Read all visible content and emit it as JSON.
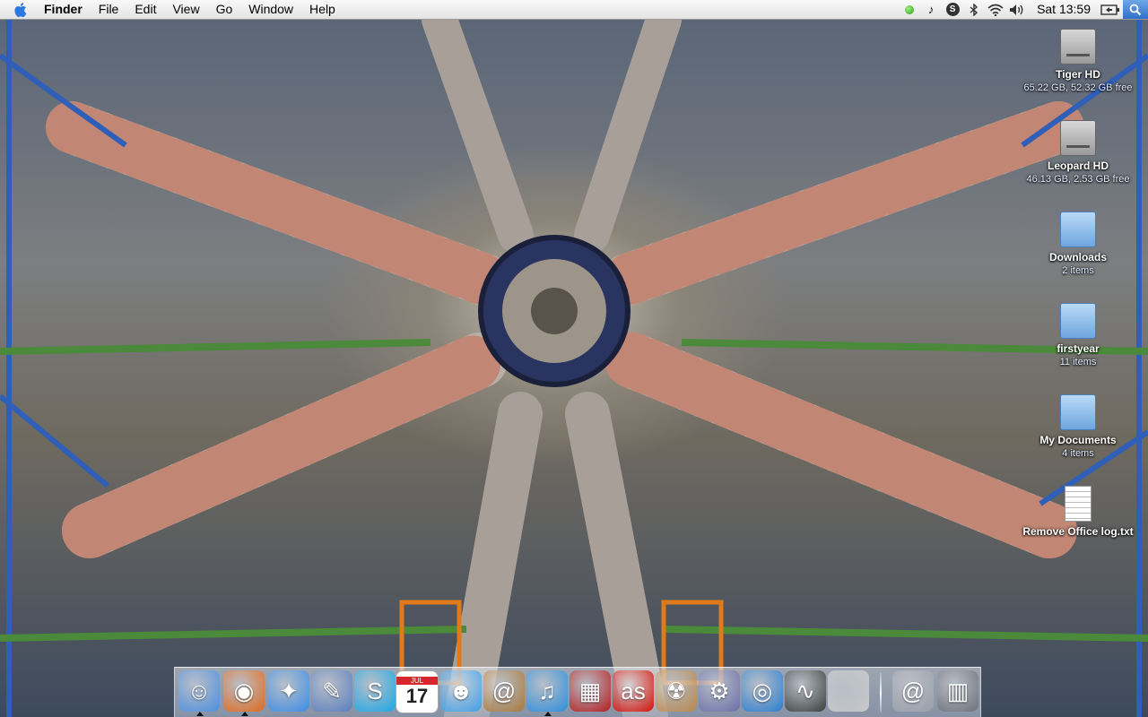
{
  "menubar": {
    "app_name": "Finder",
    "items": [
      "File",
      "Edit",
      "View",
      "Go",
      "Window",
      "Help"
    ],
    "clock": "Sat 13:59"
  },
  "status_icons": [
    "green-status-light-icon",
    "itunes-note-icon",
    "skype-status-icon",
    "bluetooth-icon",
    "wifi-icon",
    "volume-icon",
    "battery-icon",
    "spotlight-icon"
  ],
  "desktop": {
    "icons": [
      {
        "label": "Tiger HD",
        "info": "65.22 GB, 52.32 GB free",
        "kind": "hard-drive"
      },
      {
        "label": "Leopard HD",
        "info": "46.13 GB, 2.53 GB free",
        "kind": "hard-drive"
      },
      {
        "label": "Downloads",
        "info": "2 items",
        "kind": "folder"
      },
      {
        "label": "firstyear",
        "info": "11 items",
        "kind": "folder"
      },
      {
        "label": "My Documents",
        "info": "4 items",
        "kind": "folder"
      },
      {
        "label": "Remove Office log.txt",
        "info": "",
        "kind": "document"
      }
    ]
  },
  "dock": {
    "items": [
      {
        "name": "finder",
        "running": true,
        "color": "#4c8fe0"
      },
      {
        "name": "firefox",
        "running": true,
        "color": "#e36a1b"
      },
      {
        "name": "safari",
        "running": false,
        "color": "#3a8ee6"
      },
      {
        "name": "preview",
        "running": false,
        "color": "#5a7fbf"
      },
      {
        "name": "skype",
        "running": false,
        "color": "#19a9e6"
      },
      {
        "name": "ical",
        "running": false,
        "color": "#d8262d",
        "text": "17",
        "month": "JUL"
      },
      {
        "name": "ichat",
        "running": false,
        "color": "#3f9fe8"
      },
      {
        "name": "address-book",
        "running": false,
        "color": "#a8793a"
      },
      {
        "name": "itunes",
        "running": true,
        "color": "#2d8fdc"
      },
      {
        "name": "photo-booth",
        "running": false,
        "color": "#b51d1d"
      },
      {
        "name": "lastfm",
        "running": false,
        "color": "#d51007"
      },
      {
        "name": "burn-folder",
        "running": false,
        "color": "#b9874a"
      },
      {
        "name": "system-preferences",
        "running": false,
        "color": "#6b6fa8"
      },
      {
        "name": "remote-desktop",
        "running": false,
        "color": "#2b7ed1"
      },
      {
        "name": "activity-monitor",
        "running": false,
        "color": "#3b3f3b"
      },
      {
        "name": "system-profiler",
        "running": false,
        "color": "#c9c9c9"
      },
      {
        "name": "mail-stack",
        "running": false,
        "color": "#9aa0a8"
      },
      {
        "name": "trash",
        "running": false,
        "color": "#6d7178"
      }
    ]
  }
}
